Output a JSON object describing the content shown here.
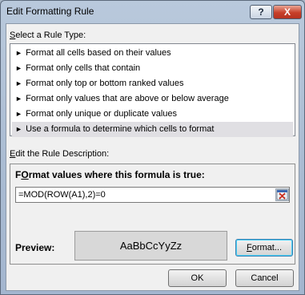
{
  "window": {
    "title": "Edit Formatting Rule",
    "help_label": "?",
    "close_label": "X"
  },
  "rule_type": {
    "label_prefix": "",
    "label_underlined": "S",
    "label_rest": "elect a Rule Type:",
    "items": [
      {
        "label": "Format all cells based on their values",
        "selected": false
      },
      {
        "label": "Format only cells that contain",
        "selected": false
      },
      {
        "label": "Format only top or bottom ranked values",
        "selected": false
      },
      {
        "label": "Format only values that are above or below average",
        "selected": false
      },
      {
        "label": "Format only unique or duplicate values",
        "selected": false
      },
      {
        "label": "Use a formula to determine which cells to format",
        "selected": true
      }
    ]
  },
  "description": {
    "label_underlined": "E",
    "label_rest": "dit the Rule Description:",
    "heading_underlined": "O",
    "heading_prefix": "F",
    "heading_rest": "rmat values where this formula is true:",
    "formula_value": "=MOD(ROW(A1),2)=0",
    "preview_label": "Preview:",
    "preview_text": "AaBbCcYyZz",
    "format_button_prefix": "",
    "format_button_underlined": "F",
    "format_button_rest": "ormat..."
  },
  "footer": {
    "ok_label": "OK",
    "cancel_label": "Cancel"
  },
  "colors": {
    "selection": "#e0dfe3",
    "close_button": "#c7402a"
  }
}
